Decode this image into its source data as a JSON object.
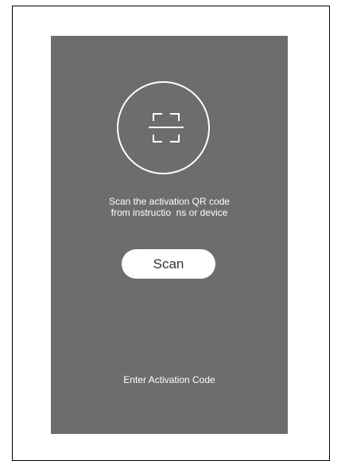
{
  "scan_panel": {
    "icon": "qr-scan-icon",
    "instruction_line_1": "Scan the activation QR code",
    "instruction_line_2": "from instructio  ns or device",
    "scan_button_label": "Scan",
    "enter_code_link": "Enter Activation Code"
  },
  "colors": {
    "panel_background": "#6d6d6d",
    "foreground": "#ffffff",
    "button_text": "#333333"
  }
}
